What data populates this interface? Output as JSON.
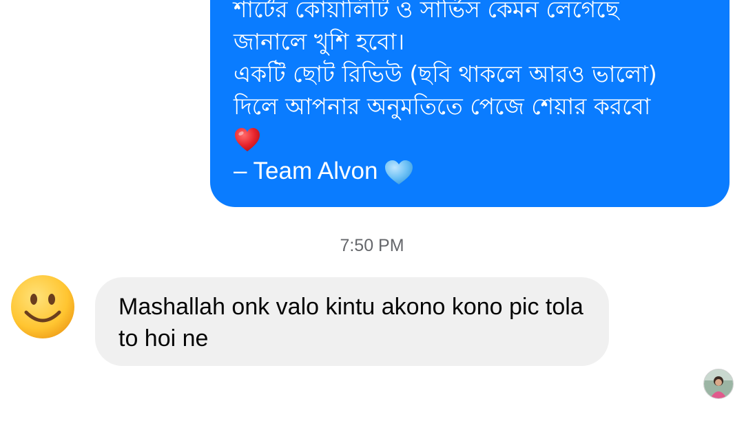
{
  "outgoing_message": {
    "lines": [
      "শার্টের কোয়ালিটি ও সার্ভিস কেমন লেগেছে",
      "জানালে খুশি হবো।",
      "একটি ছোট রিভিউ (ছবি থাকলে আরও ভালো)",
      "দিলে আপনার অনুমতিতে পেজে শেয়ার করবো"
    ],
    "heart_emoji": "red-heart-icon",
    "signature": "– Team Alvon",
    "signature_emoji": "blue-heart-icon",
    "bubble_color": "#0a7cff",
    "text_color": "#ffffff"
  },
  "timestamp": "7:50 PM",
  "incoming_message": {
    "sender_avatar": "smiley-face-icon",
    "text": "Mashallah onk valo kintu akono kono pic tola to hoi ne",
    "bubble_color": "#f0f0f0",
    "text_color": "#050505"
  },
  "seen_indicator": {
    "avatar": "user-avatar"
  }
}
